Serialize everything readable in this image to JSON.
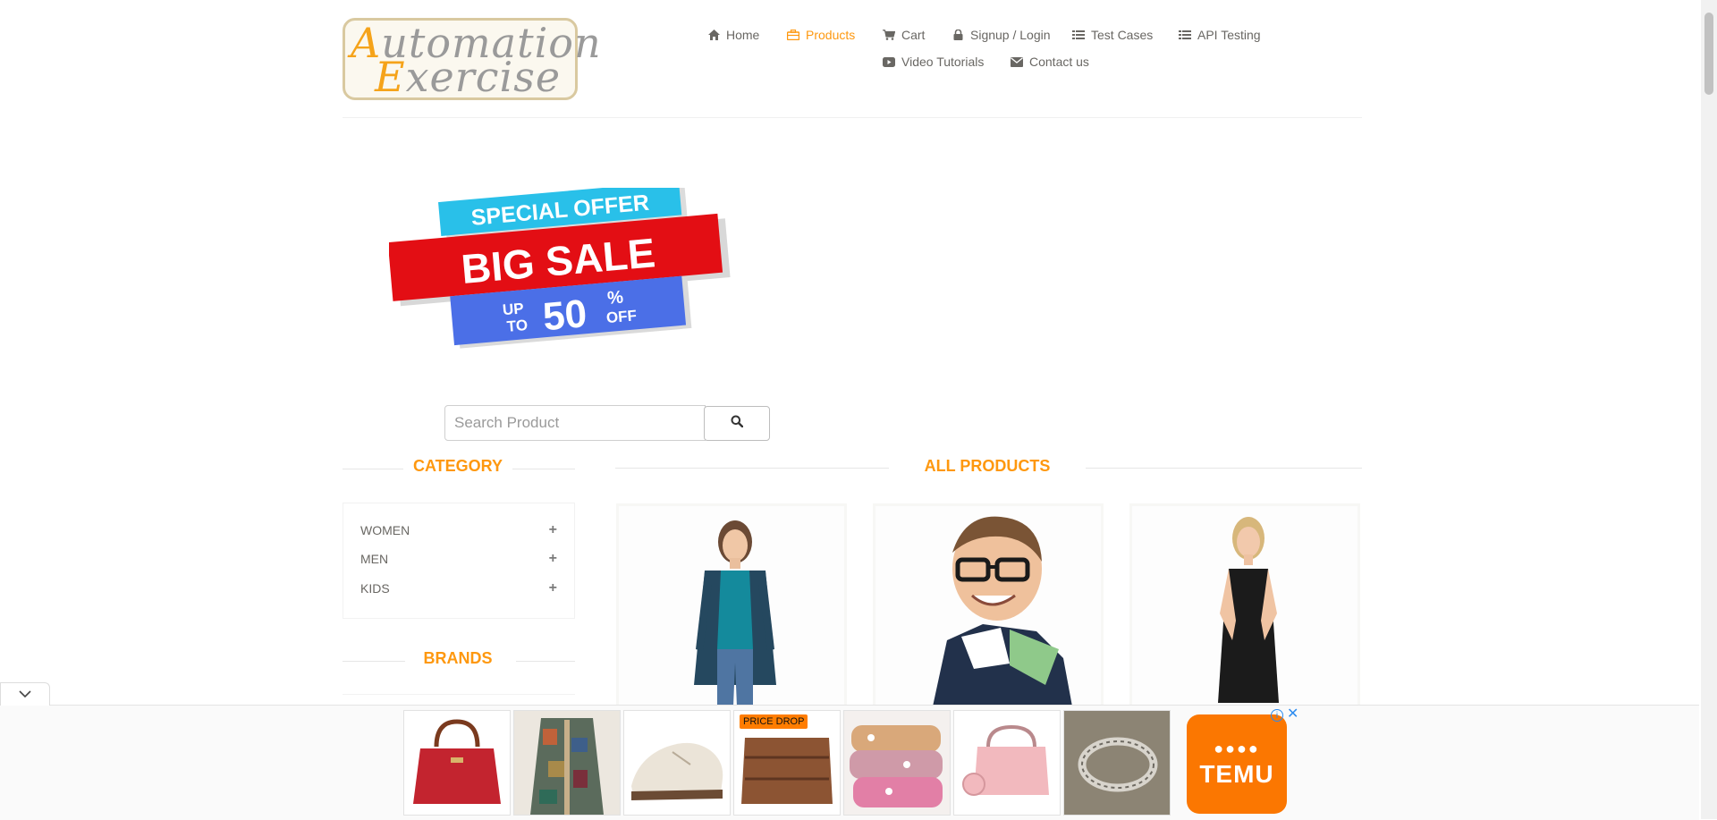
{
  "logo": {
    "line1_first": "A",
    "line1_rest": "utomation",
    "line2_first": "E",
    "line2_rest": "xercise"
  },
  "nav": {
    "home": "Home",
    "products": "Products",
    "cart": "Cart",
    "signup_login": "Signup / Login",
    "test_cases": "Test Cases",
    "api_testing": "API Testing",
    "video_tutorials": "Video Tutorials",
    "contact_us": "Contact us"
  },
  "banner": {
    "special_offer": "SPECIAL OFFER",
    "big_sale": "BIG SALE",
    "up": "UP",
    "to": "TO",
    "amount": "50",
    "percent": "%",
    "off": "OFF"
  },
  "search": {
    "placeholder": "Search Product"
  },
  "sidebar": {
    "category_title": "CATEGORY",
    "categories": [
      {
        "label": "WOMEN"
      },
      {
        "label": "MEN"
      },
      {
        "label": "KIDS"
      }
    ],
    "brands_title": "BRANDS"
  },
  "main": {
    "title": "ALL PRODUCTS"
  },
  "ad": {
    "price_drop": "PRICE DROP",
    "brand": "TEMU",
    "info_icon": "info-icon",
    "close_icon": "close-icon"
  },
  "colors": {
    "accent": "#fe980f",
    "text": "#696763",
    "temu": "#fb7701"
  }
}
